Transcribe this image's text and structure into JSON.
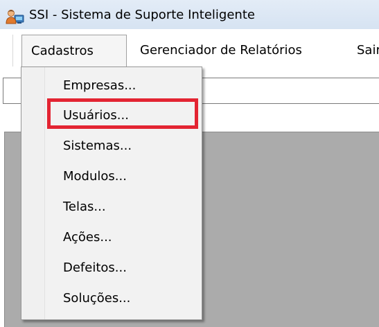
{
  "window": {
    "title": "SSI - Sistema de Suporte Inteligente",
    "icon": "user-computer-icon"
  },
  "menubar": {
    "items": [
      {
        "label": "Cadastros",
        "state": "open"
      },
      {
        "label": "Gerenciador de Relatórios"
      },
      {
        "label": "Sair"
      }
    ]
  },
  "dropdown": {
    "items": [
      {
        "label": "Empresas..."
      },
      {
        "label": "Usuários...",
        "highlighted": true
      },
      {
        "label": "Sistemas..."
      },
      {
        "label": "Modulos..."
      },
      {
        "label": "Telas..."
      },
      {
        "label": "Ações..."
      },
      {
        "label": "Defeitos..."
      },
      {
        "label": "Soluções..."
      }
    ]
  },
  "colors": {
    "titlebar": "#dbe6f3",
    "workspace": "#ababab",
    "highlight": "#e32432",
    "menu_background": "#f2f2f2"
  }
}
